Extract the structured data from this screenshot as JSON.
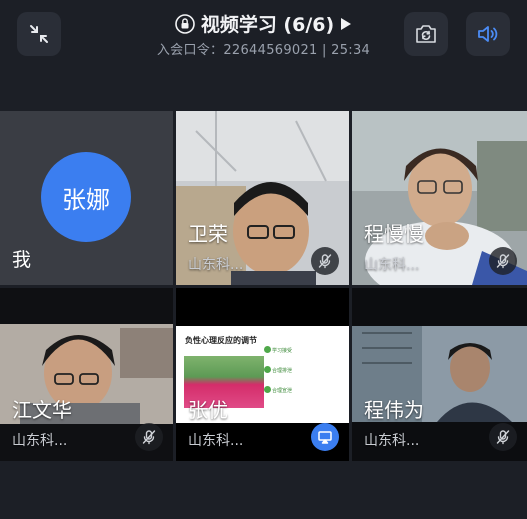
{
  "header": {
    "title": "视频学习 (6/6)",
    "meeting_info": "入会口令：22644569021 | 25:34"
  },
  "participants": [
    {
      "avatar_text": "张娜",
      "self_label": "我"
    },
    {
      "name": "卫荣",
      "org": "山东科..."
    },
    {
      "name": "程慢慢",
      "org": "山东科..."
    },
    {
      "name": "江文华",
      "org": "山东科..."
    },
    {
      "name": "张优",
      "org": "山东科...",
      "slide_title": "负性心理反应的调节",
      "slide_items": [
        "学习接受",
        "合理排泄",
        "合理宣泄"
      ]
    },
    {
      "name": "程伟为",
      "org": "山东科..."
    }
  ],
  "colors": {
    "accent": "#3b7ef0",
    "background": "#1c1f26",
    "tile": "#2b2e35"
  }
}
